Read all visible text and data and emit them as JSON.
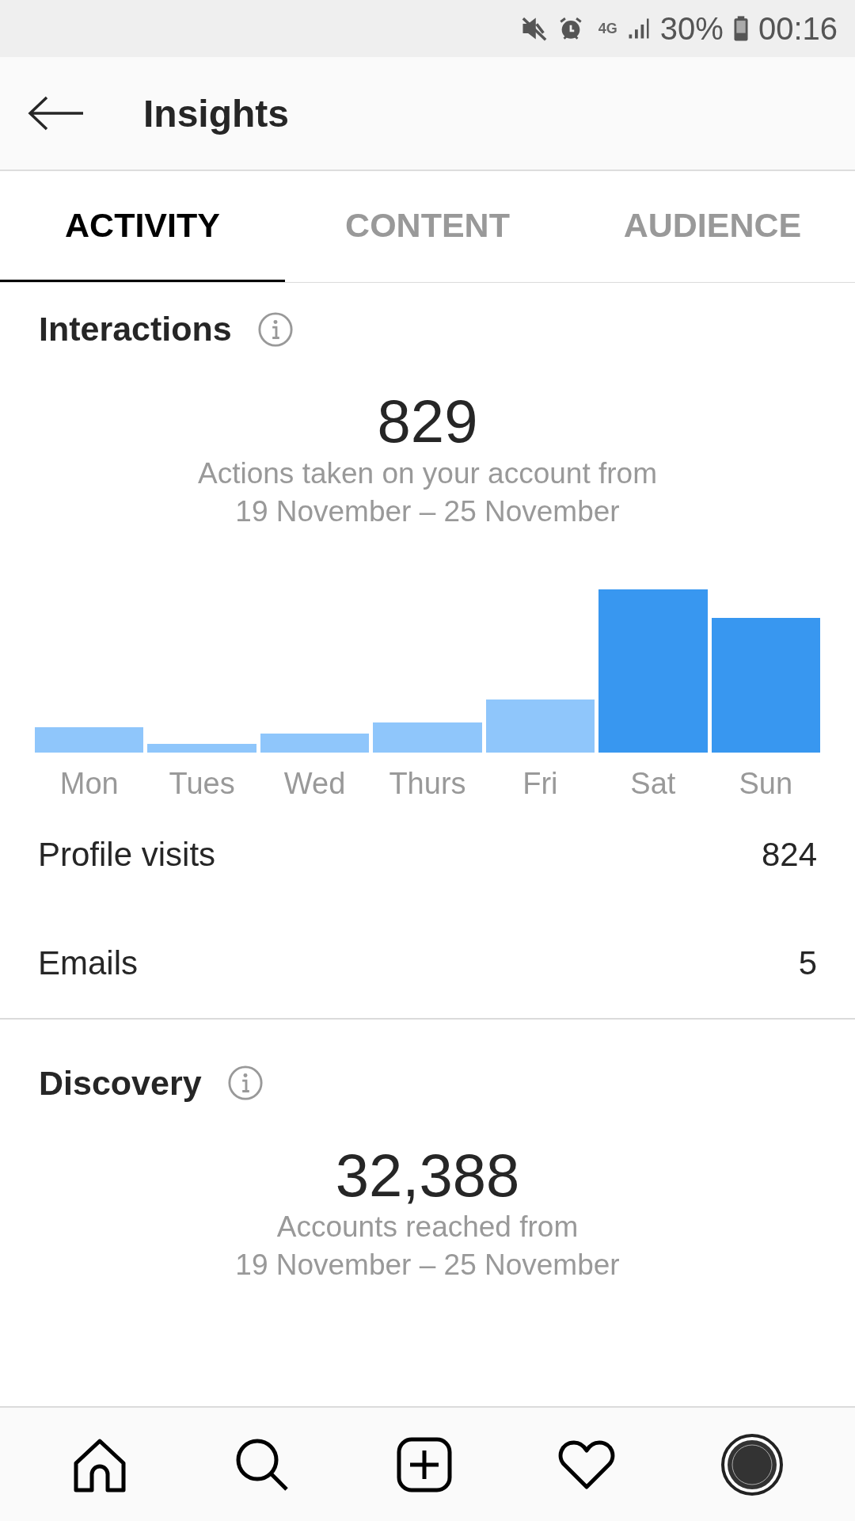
{
  "status_bar": {
    "network": "4G",
    "battery": "30%",
    "time": "00:16"
  },
  "header": {
    "title": "Insights"
  },
  "tabs": [
    {
      "label": "ACTIVITY",
      "selected": true
    },
    {
      "label": "CONTENT",
      "selected": false
    },
    {
      "label": "AUDIENCE",
      "selected": false
    }
  ],
  "interactions": {
    "title": "Interactions",
    "total": "829",
    "caption": "Actions taken on your account from",
    "range": "19 November – 25 November",
    "days": [
      {
        "label": "Mon",
        "highlighted": false
      },
      {
        "label": "Tues",
        "highlighted": false
      },
      {
        "label": "Wed",
        "highlighted": false
      },
      {
        "label": "Thurs",
        "highlighted": false
      },
      {
        "label": "Fri",
        "highlighted": false
      },
      {
        "label": "Sat",
        "highlighted": true
      },
      {
        "label": "Sun",
        "highlighted": true
      }
    ],
    "rows": [
      {
        "label": "Profile visits",
        "value": "824"
      },
      {
        "label": "Emails",
        "value": "5"
      }
    ]
  },
  "discovery": {
    "title": "Discovery",
    "total": "32,388",
    "caption": "Accounts reached from",
    "range": "19 November – 25 November"
  }
}
